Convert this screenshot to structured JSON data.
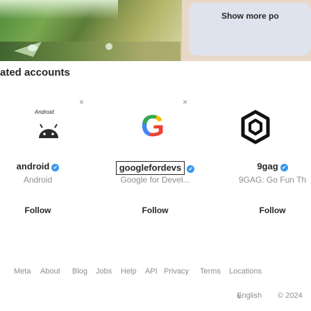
{
  "banner": {
    "show_more_label": "Show more po"
  },
  "section": {
    "title": "ated accounts"
  },
  "accounts": [
    {
      "avatar_icon": "android-robot-icon",
      "avatar_text": "Android",
      "username": "android",
      "verified_mark": "✔",
      "full_name": "Android",
      "follow_label": "Follow",
      "dismiss_label": "×"
    },
    {
      "avatar_icon": "google-g-icon",
      "avatar_text": "G",
      "username": "googlefordevs",
      "verified_mark": "✔",
      "full_name": "Google for Devel...",
      "follow_label": "Follow",
      "dismiss_label": "×"
    },
    {
      "avatar_icon": "ninegag-logo-icon",
      "username": "9gag",
      "verified_mark": "✔",
      "full_name": "9GAG: Go Fun Th",
      "follow_label": "Follow",
      "dismiss_label": ""
    }
  ],
  "footer": {
    "links": [
      "Meta",
      "About",
      "Blog",
      "Jobs",
      "Help",
      "API",
      "Privacy",
      "Terms",
      "Locations"
    ],
    "language": "English",
    "language_chevron": "∨",
    "copyright": "© 2024"
  },
  "colors": {
    "verified": "#3897f0",
    "muted_text": "#8e8e8e",
    "primary_text": "#262626"
  }
}
